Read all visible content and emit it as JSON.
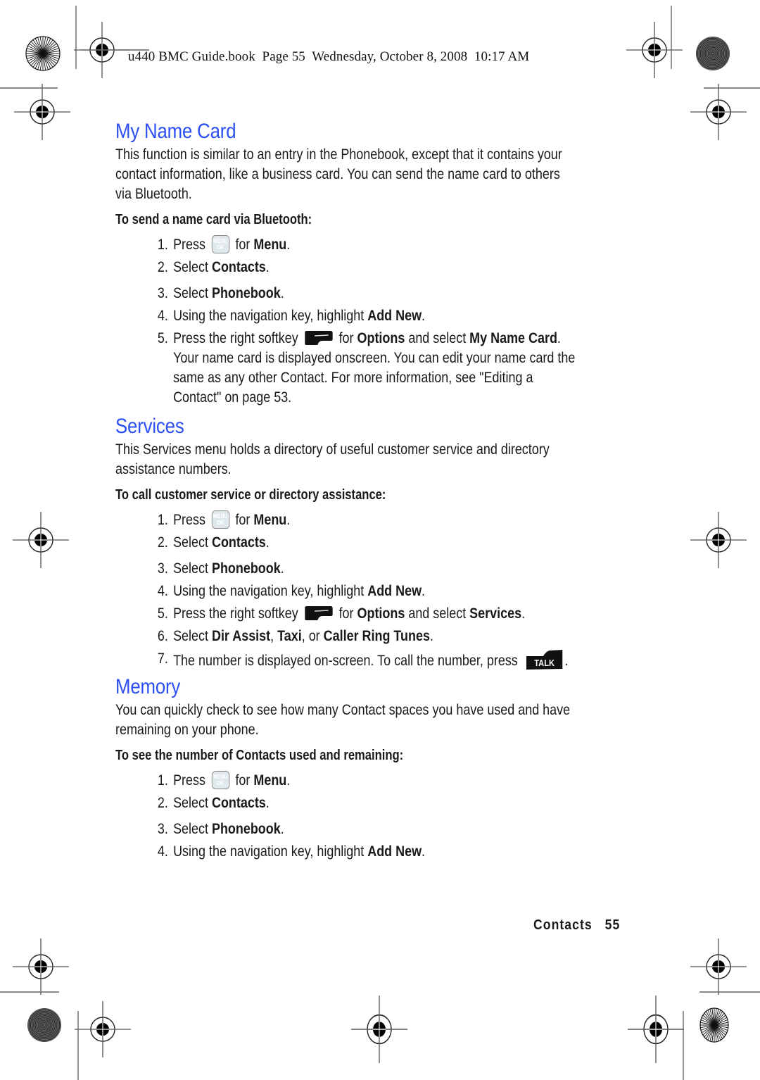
{
  "slug": {
    "text": "u440 BMC Guide.book  Page 55  Wednesday, October 8, 2008  10:17 AM"
  },
  "colors": {
    "heading": "#2b4ef5",
    "body_text": "#1a1a1a"
  },
  "icons": {
    "menu_ok_key": {
      "name": "menu-ok-key-icon",
      "line1": "MENU",
      "line2": "OK"
    },
    "right_softkey": {
      "name": "right-softkey-icon"
    },
    "talk_key": {
      "name": "talk-key-icon",
      "label": "TALK"
    },
    "registration_mark": "crosshair-registration-mark",
    "star_target": "starburst-target"
  },
  "sections": [
    {
      "title": "My Name Card",
      "intro": "This function is similar to an entry in the Phonebook, except that it contains your contact information, like a business card. You can send the name card to others via Bluetooth.",
      "intro_lines": [
        "This function is similar to an entry in the Phonebook, except that it contains your",
        "contact information, like a business card. You can send the name card to others",
        "via Bluetooth."
      ],
      "subhead": "To send a name card via Bluetooth:",
      "steps": [
        {
          "num": "1.",
          "pre": "Press ",
          "icon": "menu",
          "mid": " for ",
          "bold": "Menu",
          "post": "."
        },
        {
          "num": "2.",
          "pre": "Select ",
          "bold": "Contacts",
          "post": "."
        },
        {
          "num": "3.",
          "pre": "Select ",
          "bold": "Phonebook",
          "post": "."
        },
        {
          "num": "4.",
          "pre": "Using the navigation key, highlight ",
          "bold": "Add New",
          "post": "."
        },
        {
          "num": "5.",
          "pre": "Press the right softkey ",
          "icon": "softkey",
          "mid": " for ",
          "bold": "Options",
          "mid2": " and select ",
          "bold2": "My Name Card",
          "post": ".",
          "continuation": [
            "Your name card is displayed onscreen. You can edit your name card the",
            "same as any other Contact. For more information, see \"Editing a",
            "Contact\" on page 53."
          ]
        }
      ]
    },
    {
      "title": "Services",
      "intro_lines": [
        "This Services menu holds a directory of useful customer service and directory",
        "assistance numbers."
      ],
      "subhead": "To call customer service or directory assistance:",
      "steps": [
        {
          "num": "1.",
          "pre": "Press ",
          "icon": "menu",
          "mid": " for ",
          "bold": "Menu",
          "post": "."
        },
        {
          "num": "2.",
          "pre": "Select ",
          "bold": "Contacts",
          "post": "."
        },
        {
          "num": "3.",
          "pre": "Select ",
          "bold": "Phonebook",
          "post": "."
        },
        {
          "num": "4.",
          "pre": "Using the navigation key, highlight ",
          "bold": "Add New",
          "post": "."
        },
        {
          "num": "5.",
          "pre": "Press the right softkey ",
          "icon": "softkey",
          "mid": " for ",
          "bold": "Options",
          "mid2": " and select ",
          "bold2": "Services",
          "post": "."
        },
        {
          "num": "6.",
          "pre": "Select ",
          "bold": "Dir Assist",
          "mid2": ", ",
          "bold2": "Taxi",
          "mid3": ", or ",
          "bold3": "Caller Ring Tunes",
          "post": "."
        },
        {
          "num": "7.",
          "pre": "The number is displayed on-screen. To call the number, press ",
          "icon_end": "talk",
          "post": "."
        }
      ]
    },
    {
      "title": "Memory",
      "intro_lines": [
        "You can quickly check to see how many Contact spaces you have used and have",
        "remaining on your phone."
      ],
      "subhead": "To see the number of Contacts used and remaining:",
      "steps": [
        {
          "num": "1.",
          "pre": "Press ",
          "icon": "menu",
          "mid": " for ",
          "bold": "Menu",
          "post": "."
        },
        {
          "num": "2.",
          "pre": "Select ",
          "bold": "Contacts",
          "post": "."
        },
        {
          "num": "3.",
          "pre": "Select ",
          "bold": "Phonebook",
          "post": "."
        },
        {
          "num": "4.",
          "pre": "Using the navigation key, highlight ",
          "bold": "Add New",
          "post": "."
        }
      ]
    }
  ],
  "footer": {
    "section": "Contacts",
    "page": "55"
  }
}
